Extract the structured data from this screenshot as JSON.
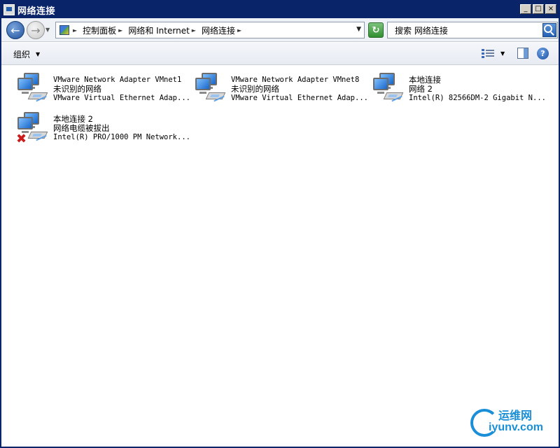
{
  "window": {
    "title": "网络连接",
    "buttons": {
      "minimize": "_",
      "maximize": "□",
      "close": "×"
    }
  },
  "navigation": {
    "breadcrumbs": [
      "控制面板",
      "网络和 Internet",
      "网络连接"
    ],
    "search_placeholder": "搜索 网络连接"
  },
  "toolbar": {
    "organize_label": "组织"
  },
  "connections": [
    {
      "name": "VMware Network Adapter VMnet1",
      "status": "未识别的网络",
      "device": "VMware Virtual Ethernet Adap...",
      "disconnected": false
    },
    {
      "name": "VMware Network Adapter VMnet8",
      "status": "未识别的网络",
      "device": "VMware Virtual Ethernet Adap...",
      "disconnected": false
    },
    {
      "name": "本地连接",
      "status": "网络  2",
      "device": "Intel(R) 82566DM-2 Gigabit N...",
      "disconnected": false
    },
    {
      "name": "本地连接 2",
      "status": "网络电缆被拔出",
      "device": "Intel(R) PRO/1000 PM Network...",
      "disconnected": true
    }
  ],
  "watermark": {
    "text_top": "运维网",
    "text_bottom": "iyunv.com",
    "color": "#1a8fd8"
  }
}
